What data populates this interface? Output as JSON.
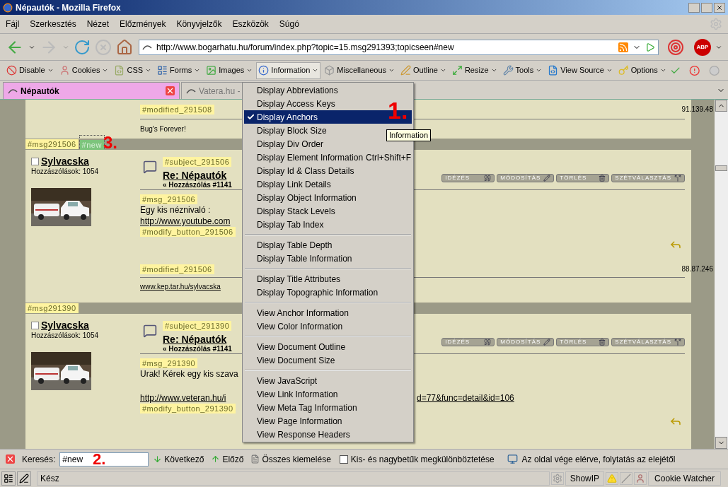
{
  "window": {
    "title": "Népautók - Mozilla Firefox"
  },
  "menu_bar": [
    "Fájl",
    "Szerkesztés",
    "Nézet",
    "Előzmények",
    "Könyvjelzők",
    "Eszközök",
    "Súgó"
  ],
  "address_bar": {
    "url": "http://www.bogarhatu.hu/forum/index.php?topic=15.msg291393;topicseen#new"
  },
  "adblock_label": "ABP",
  "webdev_toolbar": [
    {
      "label": "Disable",
      "kind": "disable",
      "open": false
    },
    {
      "label": "Cookies",
      "kind": "cookies",
      "open": false
    },
    {
      "label": "CSS",
      "kind": "css",
      "open": false
    },
    {
      "label": "Forms",
      "kind": "forms",
      "open": false
    },
    {
      "label": "Images",
      "kind": "images",
      "open": false
    },
    {
      "label": "Information",
      "kind": "information",
      "open": true
    },
    {
      "label": "Miscellaneous",
      "kind": "misc",
      "open": false
    },
    {
      "label": "Outline",
      "kind": "outline",
      "open": false
    },
    {
      "label": "Resize",
      "kind": "resize",
      "open": false
    },
    {
      "label": "Tools",
      "kind": "tools",
      "open": false
    },
    {
      "label": "View Source",
      "kind": "source",
      "open": false
    },
    {
      "label": "Options",
      "kind": "options",
      "open": false
    }
  ],
  "tabs": [
    {
      "label": "Népautók",
      "selected": true
    },
    {
      "label": "Vatera.hu -",
      "selected": false
    }
  ],
  "page": {
    "top_fragment": {
      "modified_anchor": "#modified_291508",
      "ip": "91.139.48",
      "signature": "Bug's Forever!"
    },
    "posts": [
      {
        "anchor": "#msg291506",
        "new_anchor": "#new",
        "checked": false,
        "author": "Sylvacska",
        "post_count": "Hozzászólások: 1054",
        "subject_anchor": "#subject_291506",
        "subject": "Re: Népautók",
        "meta": "« Hozzászólás #1141",
        "buttons": [
          {
            "label": "IDÉZÉS",
            "kind": "quote"
          },
          {
            "label": "MÓDOSÍTÁS",
            "kind": "modify"
          },
          {
            "label": "TÖRLÉS",
            "kind": "delete"
          },
          {
            "label": "SZÉTVÁLASZTÁS",
            "kind": "split"
          }
        ],
        "msg_anchor": "#msg_291506",
        "body": [
          [
            {
              "kind": "text",
              "text": "Egy kis néznivaló :"
            },
            {
              "kind": "link",
              "text": "http://www.youtube.com"
            }
          ]
        ],
        "modify_anchor": "#modify_button_291506",
        "modified_anchor": "#modified_291506",
        "ip": "88.87.246",
        "signature": "www.kep.tar.hu/sylvacska"
      },
      {
        "anchor": "#msg291390",
        "checked": false,
        "author": "Sylvacska",
        "post_count": "Hozzászólások: 1054",
        "subject_anchor": "#subject_291390",
        "subject": "Re: Népautók",
        "meta": "« Hozzászólás #1141",
        "buttons": [
          {
            "label": "IDÉZÉS",
            "kind": "quote"
          },
          {
            "label": "MÓDOSÍTÁS",
            "kind": "modify"
          },
          {
            "label": "TÖRLÉS",
            "kind": "delete"
          },
          {
            "label": "SZÉTVÁLASZTÁS",
            "kind": "split"
          }
        ],
        "msg_anchor": "#msg_291390",
        "body": [
          [
            {
              "kind": "text",
              "text": "Urak! Kérek egy kis szava"
            }
          ],
          [
            {
              "kind": "link",
              "text": "http://www.veteran.hu/i",
              "tail": "d=77&func=detail&id=106"
            }
          ]
        ],
        "modify_anchor": "#modify_button_291390"
      }
    ]
  },
  "information_menu": {
    "groups": [
      [
        {
          "label": "Display Abbreviations",
          "checked": false,
          "selected": false
        },
        {
          "label": "Display Access Keys",
          "checked": false,
          "selected": false
        },
        {
          "label": "Display Anchors",
          "checked": true,
          "selected": true
        },
        {
          "label": "Display Block Size",
          "checked": false,
          "selected": false
        },
        {
          "label": "Display Div Order",
          "checked": false,
          "selected": false
        },
        {
          "label": "Display Element Information",
          "shortcut": "Ctrl+Shift+F",
          "checked": false,
          "selected": false
        },
        {
          "label": "Display Id & Class Details",
          "checked": false,
          "selected": false
        },
        {
          "label": "Display Link Details",
          "checked": false,
          "selected": false
        },
        {
          "label": "Display Object Information",
          "checked": false,
          "selected": false
        },
        {
          "label": "Display Stack Levels",
          "checked": false,
          "selected": false
        },
        {
          "label": "Display Tab Index",
          "checked": false,
          "selected": false
        }
      ],
      [
        {
          "label": "Display Table Depth",
          "checked": false,
          "selected": false
        },
        {
          "label": "Display Table Information",
          "checked": false,
          "selected": false
        }
      ],
      [
        {
          "label": "Display Title Attributes",
          "checked": false,
          "selected": false
        },
        {
          "label": "Display Topographic Information",
          "checked": false,
          "selected": false
        }
      ],
      [
        {
          "label": "View Anchor Information",
          "checked": false,
          "selected": false
        },
        {
          "label": "View Color Information",
          "checked": false,
          "selected": false
        }
      ],
      [
        {
          "label": "View Document Outline",
          "checked": false,
          "selected": false
        },
        {
          "label": "View Document Size",
          "checked": false,
          "selected": false
        }
      ],
      [
        {
          "label": "View JavaScript",
          "checked": false,
          "selected": false
        },
        {
          "label": "View Link Information",
          "checked": false,
          "selected": false
        },
        {
          "label": "View Meta Tag Information",
          "checked": false,
          "selected": false
        },
        {
          "label": "View Page Information",
          "checked": false,
          "selected": false
        },
        {
          "label": "View Response Headers",
          "checked": false,
          "selected": false
        }
      ]
    ]
  },
  "tooltip": "Information",
  "find_bar": {
    "label": "Keresés:",
    "value": "#new",
    "next": "Következő",
    "previous": "Előző",
    "highlight_all": "Összes kiemelése",
    "match_case": {
      "label": "Kis- és nagybetűk megkülönböztetése",
      "checked": false
    },
    "status": "Az oldal vége elérve, folytatás az elejétől"
  },
  "status_bar": {
    "text": "Kész",
    "show_ip": "ShowIP",
    "cookie_watcher": "Cookie Watcher"
  },
  "annotations": [
    "1.",
    "2.",
    "3."
  ]
}
